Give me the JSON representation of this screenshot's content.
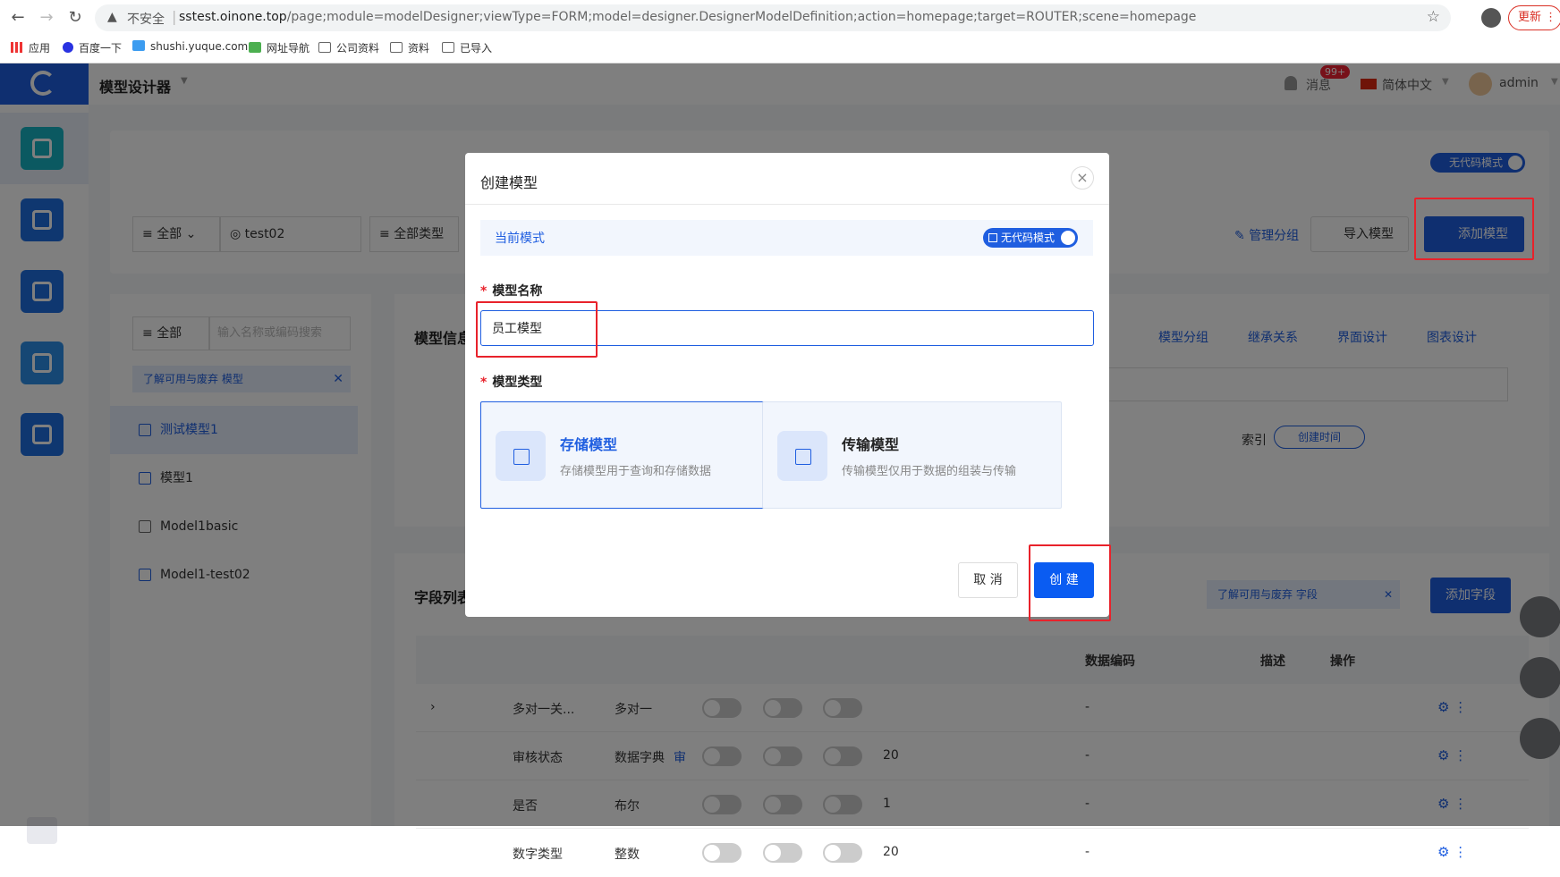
{
  "browser": {
    "insecure_label": "不安全",
    "url_host": "sstest.oinone.top",
    "url_path": "/page;module=modelDesigner;viewType=FORM;model=designer.DesignerModelDefinition;action=homepage;target=ROUTER;scene=homepage",
    "update_label": "更新",
    "bookmarks": [
      "应用",
      "百度一下",
      "shushi.yuque.com",
      "网址导航",
      "公司资料",
      "资料",
      "已导入"
    ]
  },
  "header": {
    "app_title": "模型设计器",
    "messages_label": "消息",
    "messages_badge": "99+",
    "language": "简体中文",
    "username": "admin"
  },
  "toolbar": {
    "filter_all": "全部",
    "filter_module": "test02",
    "filter_type": "全部类型",
    "nocode_label": "无代码模式",
    "manage_groups": "管理分组",
    "import_model": "导入模型",
    "add_model": "添加模型"
  },
  "tree": {
    "filter": "全部",
    "search_placeholder": "输入名称或编码搜索",
    "tip": "了解可用与废弃 模型",
    "items": [
      {
        "label": "测试模型1"
      },
      {
        "label": "模型1"
      },
      {
        "label": "Model1basic"
      },
      {
        "label": "Model1-test02"
      }
    ]
  },
  "info_panel": {
    "title": "模型信息",
    "links": [
      "模型分组",
      "继承关系",
      "界面设计",
      "图表设计"
    ],
    "index_label": "索引",
    "index_tag": "创建时间"
  },
  "fields_panel": {
    "title": "字段列表",
    "tip": "了解可用与废弃 字段",
    "add_field": "添加字段",
    "columns": {
      "data_code": "数据编码",
      "description": "描述",
      "actions": "操作"
    },
    "rows": [
      {
        "name": "多对一关...",
        "type": "多对一",
        "length": "",
        "code": "-"
      },
      {
        "name": "审核状态",
        "type": "数据字典",
        "type_extra": "审",
        "length": "20",
        "code": "-"
      },
      {
        "name": "是否",
        "type": "布尔",
        "length": "1",
        "code": "-"
      },
      {
        "name": "数字类型",
        "type": "整数",
        "length": "20",
        "code": "-"
      }
    ]
  },
  "modal": {
    "title": "创建模型",
    "mode_label": "当前模式",
    "mode_toggle": "无代码模式",
    "name_label": "模型名称",
    "name_value": "员工模型",
    "type_label": "模型类型",
    "types": [
      {
        "name": "存储模型",
        "desc": "存储模型用于查询和存储数据"
      },
      {
        "name": "传输模型",
        "desc": "传输模型仅用于数据的组装与传输"
      }
    ],
    "cancel": "取 消",
    "create": "创 建"
  },
  "colors": {
    "accent": "#1f5ee0",
    "primary_button": "#0a5cf2",
    "highlight": "#e8222b"
  }
}
